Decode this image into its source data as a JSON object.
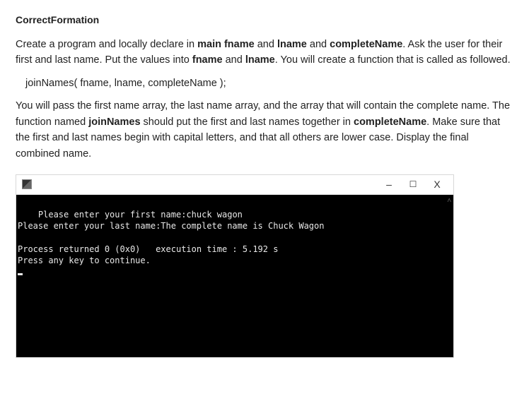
{
  "title": "CorrectFormation",
  "intro": {
    "lead": "Create a program and locally declare in ",
    "bold1": "main fname",
    "mid1": " and ",
    "bold2": "lname",
    "mid2": " and ",
    "bold3": "completeName",
    "tail1": ". Ask the user for their first and last name. Put the values into ",
    "bold4": "fname",
    "mid3": " and ",
    "bold5": "lname",
    "tail2": ". You will create a function that is called as followed."
  },
  "call_line": "joinNames( fname, lname, completeName );",
  "body": {
    "lead": "You will pass the first name array, the last name array, and the array that will contain the complete name. The function named ",
    "bold1": "joinNames",
    "mid1": " should put the first and last names together in ",
    "bold2": "completeName",
    "tail": ". Make sure that the first and last names begin with capital letters, and that all others are lower case. Display the final combined name."
  },
  "window": {
    "minimize": "–",
    "maximize": "☐",
    "close": "X",
    "scroll_up": "˄"
  },
  "console": {
    "line1": "Please enter your first name:chuck wagon",
    "line2": "Please enter your last name:The complete name is Chuck Wagon",
    "blank": "",
    "line3": "Process returned 0 (0x0)   execution time : 5.192 s",
    "line4": "Press any key to continue."
  }
}
